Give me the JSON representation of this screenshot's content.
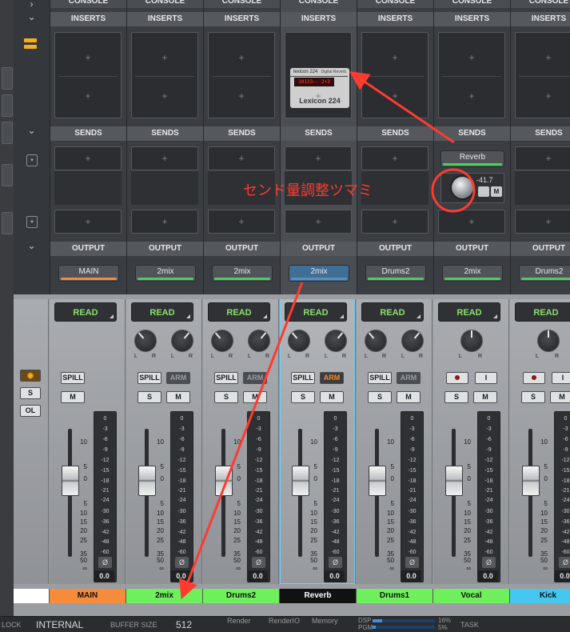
{
  "colors": {
    "annotation_red": "#ff3b30",
    "main_orange": "#f68b3a",
    "track_green": "#6df05c",
    "reverb_black": "#111111",
    "kick_blue": "#44c8f2",
    "read_green": "#8ce06a",
    "arm_orange": "#ff8a1c"
  },
  "sections": {
    "console": "CONSOLE",
    "inserts": "INSERTS",
    "sends": "SENDS",
    "output": "OUTPUT"
  },
  "insert_plugin": {
    "brand": "lexicon 224",
    "brand2": "Digital Reverb",
    "display": "10133-- 2+3",
    "name": "Lexicon 224"
  },
  "send": {
    "name": "Reverb",
    "value": "-41.7",
    "mute_label": "M"
  },
  "annotation": {
    "text": "センド量調整ツマミ"
  },
  "channels": [
    {
      "output": "",
      "name": "",
      "name_color": "#ffffff"
    },
    {
      "output": "MAIN",
      "output_bar": "#f68b3a",
      "name": "MAIN",
      "name_color": "#f68b3a"
    },
    {
      "output": "2mix",
      "output_bar": "#46d25a",
      "name": "2mix",
      "name_color": "#6df05c"
    },
    {
      "output": "2mix",
      "output_bar": "#46d25a",
      "name": "Drums2",
      "name_color": "#6df05c"
    },
    {
      "output": "2mix",
      "output_bar": "#5a8fb8",
      "name": "Reverb",
      "name_color": "#111111"
    },
    {
      "output": "Drums2",
      "output_bar": "#46d25a",
      "name": "Drums1",
      "name_color": "#6df05c"
    },
    {
      "output": "2mix",
      "output_bar": "#46d25a",
      "name": "Vocal",
      "name_color": "#6df05c"
    },
    {
      "output": "Drums2",
      "output_bar": "#46d25a",
      "name": "Kick",
      "name_color": "#44c8f2"
    }
  ],
  "strip": {
    "read": "READ",
    "spill": "SPILL",
    "arm": "ARM",
    "solo": "S",
    "mute": "M",
    "ol": "OL",
    "pan_l": "L",
    "pan_r": "R",
    "phase": "Ø",
    "meter_value": "0.0",
    "input_icon": "I"
  },
  "fader_scale": [
    "10",
    "5",
    "0",
    "5",
    "10",
    "15",
    "20",
    "25",
    "35",
    "50",
    "∞"
  ],
  "meter_scale": [
    "0",
    "-3",
    "-6",
    "-9",
    "-12",
    "-15",
    "-18",
    "-21",
    "-24",
    "-30",
    "-36",
    "-42",
    "-48",
    "-60"
  ],
  "bottombar": {
    "clock": "LOCK",
    "internal": "INTERNAL",
    "buffer_label": "BUFFER SIZE",
    "buffer_value": "512",
    "render": "Render",
    "renderio": "RenderIO",
    "memory": "Memory",
    "dsp": "DSP",
    "pgm": "PGM",
    "pct1": "16%",
    "pct2": "5%",
    "task": "TASK"
  }
}
